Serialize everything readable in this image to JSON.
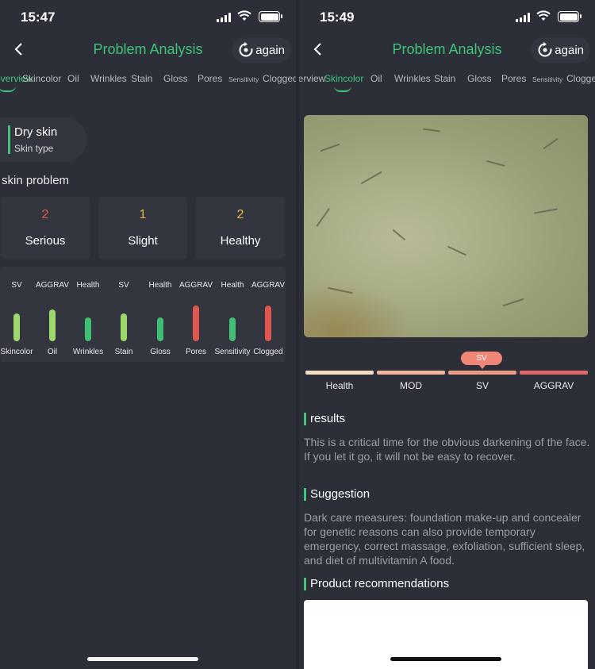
{
  "left": {
    "status_time": "15:47",
    "title": "Problem Analysis",
    "again_label": "again",
    "tabs": [
      "overview",
      "Skincolor",
      "Oil",
      "Wrinkles",
      "Stain",
      "Gloss",
      "Pores",
      "Sensitivity",
      "Clogged"
    ],
    "active_tab": "overview",
    "skin_type": {
      "value": "Dry skin",
      "label": "Skin type"
    },
    "section_label": "skin problem",
    "stats": [
      {
        "count": "2",
        "label": "Serious",
        "color": "#e0574f"
      },
      {
        "count": "1",
        "label": "Slight",
        "color": "#e8b54a"
      },
      {
        "count": "2",
        "label": "Healthy",
        "color": "#e8b54a"
      }
    ],
    "bars": [
      {
        "level": "SV",
        "name": "Skincolor",
        "color": "#9fd86a",
        "fill": 0.7
      },
      {
        "level": "AGGRAV",
        "name": "Oil",
        "color": "#9fd86a",
        "fill": 0.8
      },
      {
        "level": "Health",
        "name": "Wrinkles",
        "color": "#3fbf74",
        "fill": 0.6
      },
      {
        "level": "SV",
        "name": "Stain",
        "color": "#9fd86a",
        "fill": 0.7
      },
      {
        "level": "Health",
        "name": "Gloss",
        "color": "#3fbf74",
        "fill": 0.6
      },
      {
        "level": "AGGRAV",
        "name": "Pores",
        "color": "#e0574f",
        "fill": 0.9
      },
      {
        "level": "Health",
        "name": "Sensitivity",
        "color": "#3fbf74",
        "fill": 0.6
      },
      {
        "level": "AGGRAV",
        "name": "Clogged",
        "color": "#e0574f",
        "fill": 0.9
      }
    ]
  },
  "right": {
    "status_time": "15:49",
    "title": "Problem Analysis",
    "again_label": "again",
    "tabs": [
      "overview",
      "Skincolor",
      "Oil",
      "Wrinkles",
      "Stain",
      "Gloss",
      "Pores",
      "Sensitivity",
      "Clogged"
    ],
    "active_tab": "Skincolor",
    "scale": {
      "levels": [
        "Health",
        "MOD",
        "SV",
        "AGGRAV"
      ],
      "colors": [
        "#f4dcc0",
        "#f1b49c",
        "#ee9a86",
        "#e0666a"
      ],
      "current": "SV"
    },
    "results_title": "results",
    "results_text": "This is a critical time for the obvious darkening of the face. If you let it go, it will not be easy to recover.",
    "suggestion_title": "Suggestion",
    "suggestion_text": "Dark care measures: foundation make-up and concealer for genetic reasons can also provide temporary emergency, correct massage, exfoliation, sufficient sleep, and diet of multivitamin A food.",
    "products_title": "Product recommendations"
  },
  "icons": [
    "back-arrow-icon",
    "refresh-icon",
    "signal-icon",
    "wifi-icon",
    "battery-icon"
  ],
  "accent_color": "#3fc27b"
}
